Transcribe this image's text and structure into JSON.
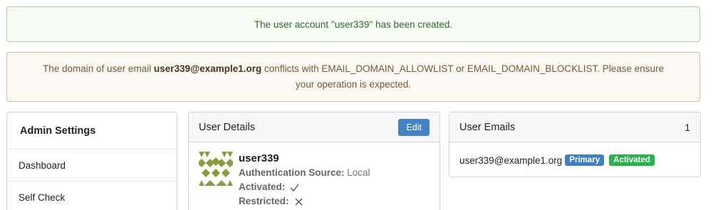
{
  "flash": {
    "success": "The user account \"user339\" has been created.",
    "warning_prefix": "The domain of user email ",
    "warning_email": "user339@example1.org",
    "warning_suffix": " conflicts with EMAIL_DOMAIN_ALLOWLIST or EMAIL_DOMAIN_BLOCKLIST. Please ensure your operation is expected."
  },
  "sidebar": {
    "title": "Admin Settings",
    "items": [
      {
        "label": "Dashboard"
      },
      {
        "label": "Self Check"
      }
    ]
  },
  "user_details": {
    "title": "User Details",
    "edit_label": "Edit",
    "username": "user339",
    "auth_source_label": "Authentication Source:",
    "auth_source_value": "Local",
    "activated_label": "Activated:",
    "activated_icon": "check-icon",
    "restricted_label": "Restricted:",
    "restricted_icon": "x-icon"
  },
  "user_emails": {
    "title": "User Emails",
    "count": "1",
    "items": [
      {
        "email": "user339@example1.org",
        "primary_badge": "Primary",
        "status_badge": "Activated"
      }
    ]
  },
  "colors": {
    "edit_button": "#4183c4",
    "badge_primary": "#3c7fc6",
    "badge_activated": "#27b24a",
    "avatar": "#8c9a3b"
  }
}
